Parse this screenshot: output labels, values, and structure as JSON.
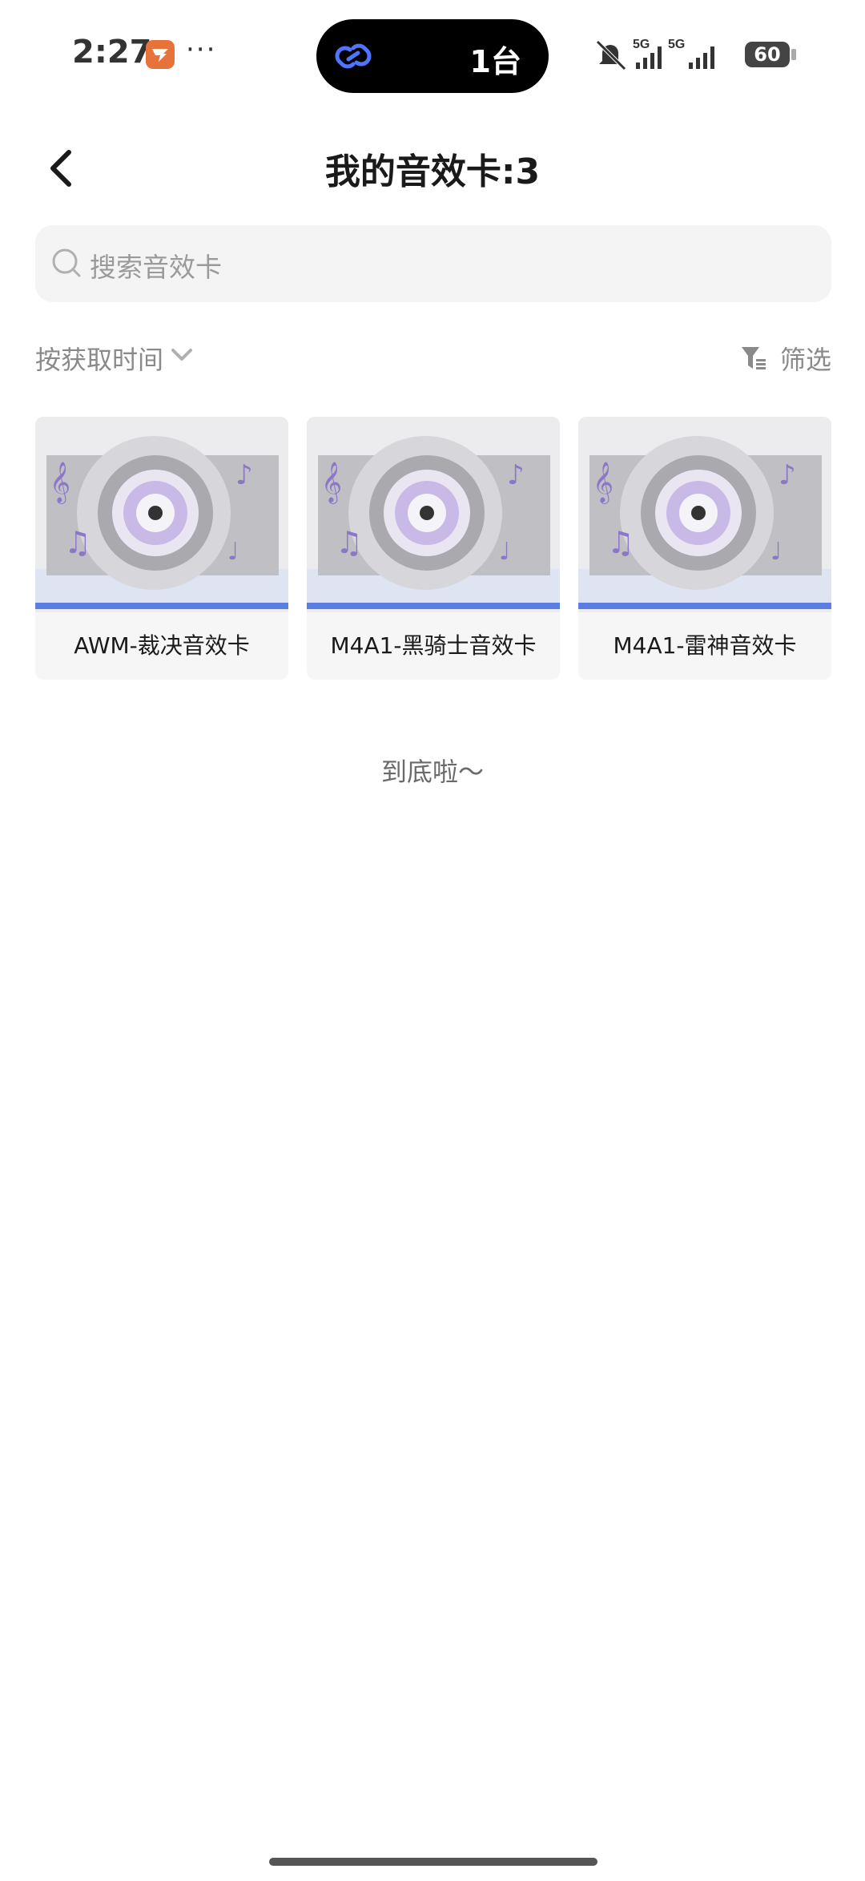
{
  "status_bar": {
    "time": "2:27",
    "app_notification_icon": "app-logo-icon",
    "more": "···",
    "island_text": "1台",
    "signal_1": "5G",
    "signal_2": "5G",
    "battery": "60"
  },
  "header": {
    "title": "我的音效卡:3"
  },
  "search": {
    "placeholder": "搜索音效卡"
  },
  "sort": {
    "label": "按获取时间",
    "filter_label": "筛选"
  },
  "cards": [
    {
      "label": "AWM-裁决音效卡"
    },
    {
      "label": "M4A1-黑骑士音效卡"
    },
    {
      "label": "M4A1-雷神音效卡"
    }
  ],
  "footer": {
    "end_text": "到底啦～"
  },
  "colors": {
    "accent_blue": "#5b7fe0",
    "island_link": "#4f74ff",
    "app_badge": "#e8733a"
  }
}
